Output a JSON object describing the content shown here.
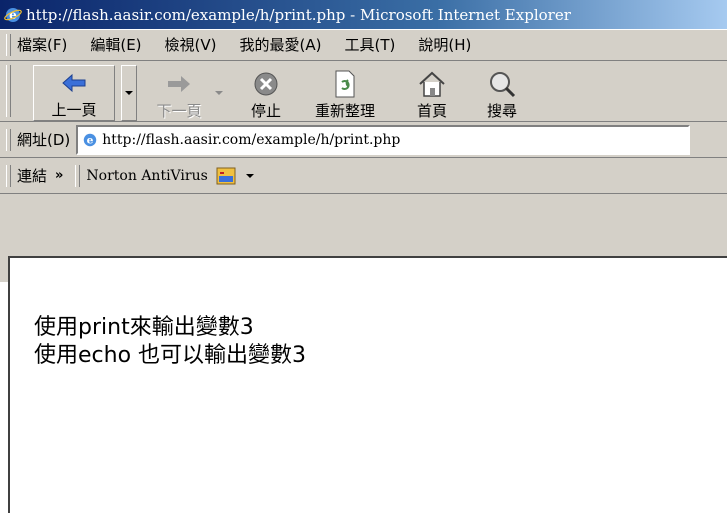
{
  "window": {
    "title": "http://flash.aasir.com/example/h/print.php - Microsoft Internet Explorer",
    "icon": "ie-icon"
  },
  "menu": {
    "items": [
      "檔案(F)",
      "編輯(E)",
      "檢視(V)",
      "我的最愛(A)",
      "工具(T)",
      "說明(H)"
    ]
  },
  "toolbar": {
    "back_label": "上一頁",
    "forward_label": "下一頁",
    "stop_label": "停止",
    "refresh_label": "重新整理",
    "home_label": "首頁",
    "search_label": "搜尋",
    "icons": {
      "back": "back-arrow-icon",
      "forward": "forward-arrow-icon",
      "stop": "stop-icon",
      "refresh": "refresh-icon",
      "home": "home-icon",
      "search": "search-icon"
    },
    "accent": "#3a6fd8"
  },
  "address": {
    "label": "網址(D)",
    "value": "http://flash.aasir.com/example/h/print.php"
  },
  "links": {
    "label": "連結",
    "chevron": "»",
    "norton": "Norton AntiVirus"
  },
  "page": {
    "lines": [
      "使用print來輸出變數3",
      "使用echo 也可以輸出變數3"
    ]
  },
  "colors": {
    "titlebar_start": "#0a246a",
    "titlebar_end": "#a6caf0",
    "chrome": "#d4d0c8"
  }
}
